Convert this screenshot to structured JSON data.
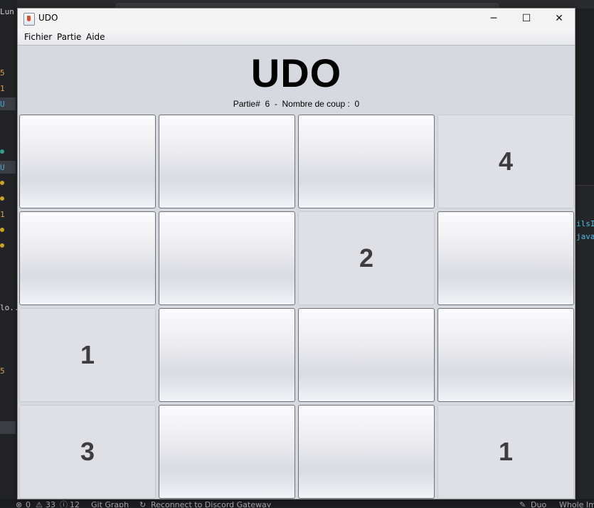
{
  "window": {
    "title": "UDO",
    "menu": [
      "Fichier",
      "Partie",
      "Aide"
    ],
    "controls": {
      "minimize": "─",
      "maximize": "☐",
      "close": "✕"
    }
  },
  "game": {
    "title": "UDO",
    "partie_label": "Partie#",
    "partie_number": "6",
    "separator": "-",
    "coups_label": "Nombre de coup :",
    "coups_count": "0",
    "cells": [
      {
        "value": "",
        "revealed": false
      },
      {
        "value": "",
        "revealed": false
      },
      {
        "value": "",
        "revealed": false
      },
      {
        "value": "4",
        "revealed": true
      },
      {
        "value": "",
        "revealed": false
      },
      {
        "value": "",
        "revealed": false
      },
      {
        "value": "2",
        "revealed": true
      },
      {
        "value": "",
        "revealed": false
      },
      {
        "value": "1",
        "revealed": true
      },
      {
        "value": "",
        "revealed": false
      },
      {
        "value": "",
        "revealed": false
      },
      {
        "value": "",
        "revealed": false
      },
      {
        "value": "3",
        "revealed": true
      },
      {
        "value": "",
        "revealed": false
      },
      {
        "value": "",
        "revealed": false
      },
      {
        "value": "1",
        "revealed": true
      }
    ]
  },
  "background": {
    "top_left": "Lun",
    "left_numbers": [
      "5",
      "1",
      "U",
      "U",
      "1",
      "lo...",
      "5"
    ],
    "right_code": [
      "ilsI",
      "java"
    ],
    "status": {
      "errors": "0",
      "warnings": "33",
      "info": "12",
      "git": "Git Graph",
      "discord": "Reconnect to Discord Gateway",
      "duo": "Duo",
      "whole": "Whole Im"
    }
  }
}
